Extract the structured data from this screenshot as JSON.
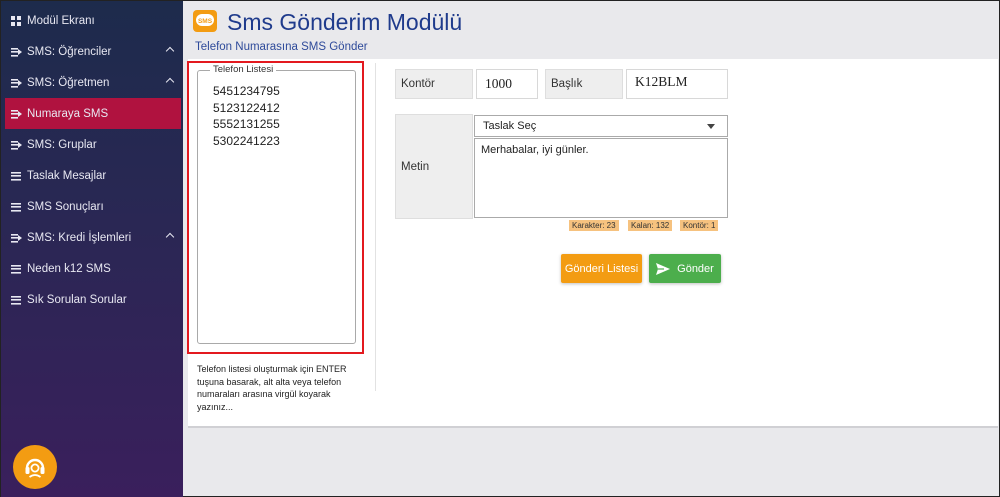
{
  "sidebar": {
    "items": [
      {
        "label": "Modül Ekranı",
        "icon": "grid-icon"
      },
      {
        "label": "SMS: Öğrenciler",
        "icon": "list-arrow-icon",
        "expandable": true
      },
      {
        "label": "SMS: Öğretmen",
        "icon": "list-arrow-icon",
        "expandable": true
      },
      {
        "label": "Numaraya SMS",
        "icon": "list-arrow-icon",
        "active": true
      },
      {
        "label": "SMS: Gruplar",
        "icon": "list-arrow-icon"
      },
      {
        "label": "Taslak Mesajlar",
        "icon": "list-icon"
      },
      {
        "label": "SMS Sonuçları",
        "icon": "list-icon"
      },
      {
        "label": "SMS: Kredi İşlemleri",
        "icon": "list-arrow-icon",
        "expandable": true
      },
      {
        "label": "Neden k12 SMS",
        "icon": "list-icon"
      },
      {
        "label": "Sık Sorulan Sorular",
        "icon": "list-icon"
      }
    ],
    "active_color": "#b0123f"
  },
  "header": {
    "logo_text": "SMS",
    "title": "Sms Gönderim Modülü",
    "subtitle": "Telefon Numarasına SMS Gönder"
  },
  "phone_list": {
    "legend": "Telefon Listesi",
    "numbers": [
      "5451234795",
      "5123122412",
      "5552131255",
      "5302241223"
    ],
    "hint": "Telefon listesi oluşturmak için ENTER tuşuna basarak, alt alta veya telefon numaraları arasına virgül koyarak yazınız..."
  },
  "form": {
    "kontor_label": "Kontör",
    "kontor_value": "1000",
    "baslik_label": "Başlık",
    "baslik_value": "K12BLM",
    "metin_label": "Metin",
    "template_select": "Taslak Seç",
    "message": "Merhabalar, iyi günler.",
    "counters": {
      "karakter": "Karakter: 23",
      "kalan": "Kalan: 132",
      "kontor": "Kontör: 1"
    }
  },
  "buttons": {
    "list_label": "Gönderi Listesi",
    "send_label": "Gönder"
  },
  "colors": {
    "title": "#1f3b8c",
    "orange": "#f39c12",
    "green": "#4cae4c",
    "highlight": "#e3191f"
  }
}
